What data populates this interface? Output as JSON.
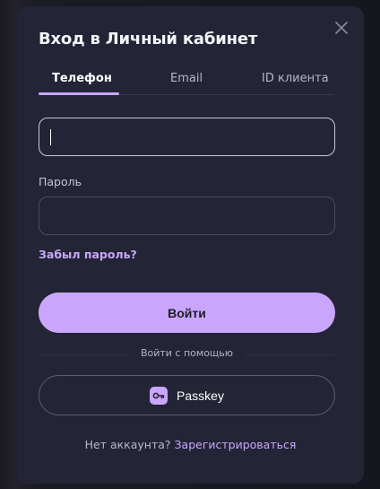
{
  "dialog": {
    "title": "Вход в Личный кабинет"
  },
  "tabs": [
    {
      "label": "Телефон",
      "active": true
    },
    {
      "label": "Email",
      "active": false
    },
    {
      "label": "ID клиента",
      "active": false
    }
  ],
  "phone_input": {
    "value": "",
    "placeholder": ""
  },
  "password": {
    "label": "Пароль",
    "value": "",
    "placeholder": ""
  },
  "forgot_link": "Забыл пароль?",
  "login_button": "Войти",
  "divider_text": "Войти с помощью",
  "passkey_button": "Passkey",
  "register": {
    "prompt": "Нет аккаунта?",
    "link": "Зарегистрироваться"
  },
  "colors": {
    "accent": "#c9a6fb",
    "modal_bg": "#232435",
    "text_primary": "#ffffff"
  },
  "icons": [
    "close-icon",
    "key-icon"
  ]
}
